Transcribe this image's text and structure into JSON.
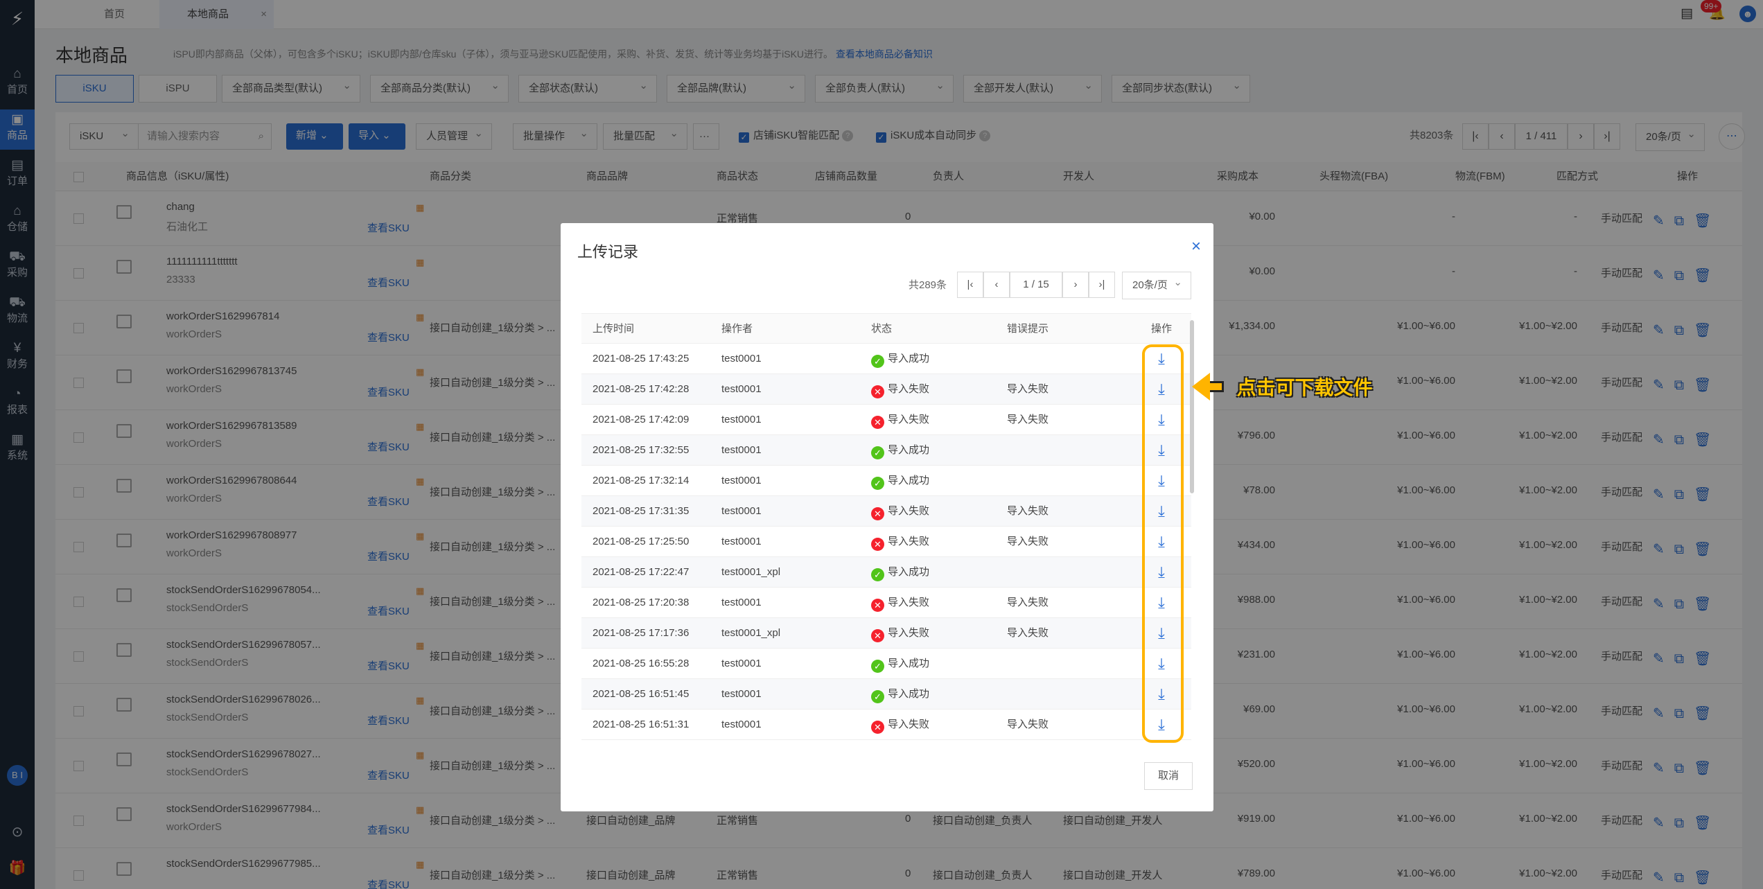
{
  "topbar": {
    "tabs": [
      {
        "label": "首页"
      },
      {
        "label": "本地商品"
      }
    ],
    "close": "×",
    "badge": "99+"
  },
  "sidebar": {
    "items": [
      {
        "label": "首页",
        "icon": "home-icon"
      },
      {
        "label": "商品",
        "icon": "box-icon"
      },
      {
        "label": "订单",
        "icon": "order-icon"
      },
      {
        "label": "仓储",
        "icon": "warehouse-icon"
      },
      {
        "label": "采购",
        "icon": "cart-icon"
      },
      {
        "label": "物流",
        "icon": "truck-icon"
      },
      {
        "label": "财务",
        "icon": "finance-icon"
      },
      {
        "label": "报表",
        "icon": "report-icon"
      },
      {
        "label": "系统",
        "icon": "system-icon"
      }
    ],
    "avatar": "B I"
  },
  "page": {
    "title": "本地商品",
    "desc": "iSPU即内部商品（父体），可包含多个iSKU；iSKU即内部/仓库sku（子体），须与亚马逊SKU匹配使用，采购、补货、发货、统计等业务均基于iSKU进行。",
    "desc_link": "查看本地商品必备知识"
  },
  "filters": {
    "seg": [
      "iSKU",
      "iSPU"
    ],
    "dropdowns": [
      "全部商品类型(默认)",
      "全部商品分类(默认)",
      "全部状态(默认)",
      "全部品牌(默认)",
      "全部负责人(默认)",
      "全部开发人(默认)",
      "全部同步状态(默认)"
    ]
  },
  "toolbar": {
    "field": "iSKU",
    "search_placeholder": "请输入搜索内容",
    "add": "新增",
    "import": "导入",
    "people": "人员管理",
    "batch": "批量操作",
    "match": "批量匹配",
    "more": "···",
    "cb1": "店铺iSKU智能匹配",
    "cb2": "iSKU成本自动同步",
    "total": "共8203条",
    "page": "1",
    "pages": "/ 411",
    "per_page": "20条/页"
  },
  "table": {
    "headers": [
      "商品信息（iSKU/属性)",
      "商品分类",
      "商品品牌",
      "商品状态",
      "店铺商品数量",
      "负责人",
      "开发人",
      "采购成本",
      "头程物流(FBA)",
      "物流(FBM)",
      "匹配方式",
      "操作"
    ],
    "view_sku": "查看SKU",
    "rows": [
      {
        "name": "chang",
        "sub": "石油化工",
        "cat": "",
        "brand": "",
        "status": "正常销售",
        "qty": "0",
        "owner": "",
        "dev": "",
        "cost": "¥0.00",
        "fba": "-",
        "fbm": "-",
        "match": "手动匹配"
      },
      {
        "name": "1111111111ttttttt",
        "sub": "23333",
        "cat": "",
        "brand": "",
        "status": "",
        "qty": "",
        "owner": "",
        "dev": "",
        "cost": "¥0.00",
        "fba": "-",
        "fbm": "-",
        "match": "手动匹配"
      },
      {
        "name": "workOrderS1629967814",
        "sub": "workOrderS",
        "cat": "接口自动创建_1级分类 > ...",
        "brand": "",
        "status": "",
        "qty": "",
        "owner": "",
        "dev": "",
        "cost": "¥1,334.00",
        "fba": "¥1.00~¥6.00",
        "fbm": "¥1.00~¥2.00",
        "match": "手动匹配"
      },
      {
        "name": "workOrderS1629967813745",
        "sub": "workOrderS",
        "cat": "接口自动创建_1级分类 > ...",
        "brand": "",
        "status": "",
        "qty": "",
        "owner": "",
        "dev": "",
        "cost": "",
        "fba": "¥1.00~¥6.00",
        "fbm": "¥1.00~¥2.00",
        "match": "手动匹配"
      },
      {
        "name": "workOrderS1629967813589",
        "sub": "workOrderS",
        "cat": "接口自动创建_1级分类 > ...",
        "brand": "",
        "status": "",
        "qty": "",
        "owner": "",
        "dev": "",
        "cost": "¥796.00",
        "fba": "¥1.00~¥6.00",
        "fbm": "¥1.00~¥2.00",
        "match": "手动匹配"
      },
      {
        "name": "workOrderS1629967808644",
        "sub": "workOrderS",
        "cat": "接口自动创建_1级分类 > ...",
        "brand": "",
        "status": "",
        "qty": "",
        "owner": "",
        "dev": "",
        "cost": "¥78.00",
        "fba": "¥1.00~¥6.00",
        "fbm": "¥1.00~¥2.00",
        "match": "手动匹配"
      },
      {
        "name": "workOrderS1629967808977",
        "sub": "workOrderS",
        "cat": "接口自动创建_1级分类 > ...",
        "brand": "",
        "status": "",
        "qty": "",
        "owner": "",
        "dev": "",
        "cost": "¥434.00",
        "fba": "¥1.00~¥6.00",
        "fbm": "¥1.00~¥2.00",
        "match": "手动匹配"
      },
      {
        "name": "stockSendOrderS16299678054...",
        "sub": "stockSendOrderS",
        "cat": "接口自动创建_1级分类 > ...",
        "brand": "",
        "status": "",
        "qty": "",
        "owner": "",
        "dev": "",
        "cost": "¥988.00",
        "fba": "¥1.00~¥6.00",
        "fbm": "¥1.00~¥2.00",
        "match": "手动匹配"
      },
      {
        "name": "stockSendOrderS16299678057...",
        "sub": "stockSendOrderS",
        "cat": "接口自动创建_1级分类 > ...",
        "brand": "",
        "status": "",
        "qty": "",
        "owner": "",
        "dev": "",
        "cost": "¥231.00",
        "fba": "¥1.00~¥6.00",
        "fbm": "¥1.00~¥2.00",
        "match": "手动匹配"
      },
      {
        "name": "stockSendOrderS16299678026...",
        "sub": "stockSendOrderS",
        "cat": "接口自动创建_1级分类 > ...",
        "brand": "",
        "status": "",
        "qty": "",
        "owner": "",
        "dev": "",
        "cost": "¥69.00",
        "fba": "¥1.00~¥6.00",
        "fbm": "¥1.00~¥2.00",
        "match": "手动匹配"
      },
      {
        "name": "stockSendOrderS16299678027...",
        "sub": "stockSendOrderS",
        "cat": "接口自动创建_1级分类 > ...",
        "brand": "",
        "status": "",
        "qty": "",
        "owner": "",
        "dev": "",
        "cost": "¥520.00",
        "fba": "¥1.00~¥6.00",
        "fbm": "¥1.00~¥2.00",
        "match": "手动匹配"
      },
      {
        "name": "stockSendOrderS16299677984...",
        "sub": "workOrderS",
        "cat": "接口自动创建_1级分类 > ...",
        "brand": "接口自动创建_品牌",
        "status": "正常销售",
        "qty": "0",
        "owner": "接口自动创建_负责人",
        "dev": "接口自动创建_开发人",
        "cost": "¥919.00",
        "fba": "¥1.00~¥6.00",
        "fbm": "¥1.00~¥2.00",
        "match": "手动匹配"
      },
      {
        "name": "stockSendOrderS16299677985...",
        "sub": "",
        "cat": "接口自动创建_1级分类 > ...",
        "brand": "接口自动创建_品牌",
        "status": "正常销售",
        "qty": "0",
        "owner": "接口自动创建_负责人",
        "dev": "接口自动创建_开发人",
        "cost": "¥789.00",
        "fba": "¥1.00~¥6.00",
        "fbm": "¥1.00~¥2.00",
        "match": "手动匹配"
      }
    ]
  },
  "modal": {
    "title": "上传记录",
    "close": "×",
    "total": "共289条",
    "page": "1",
    "pages": "/ 15",
    "per_page": "20条/页",
    "headers": [
      "上传时间",
      "操作者",
      "状态",
      "错误提示",
      "操作"
    ],
    "rows": [
      {
        "time": "2021-08-25 17:43:25",
        "user": "test0001",
        "ok": true,
        "status": "导入成功",
        "err": ""
      },
      {
        "time": "2021-08-25 17:42:28",
        "user": "test0001",
        "ok": false,
        "status": "导入失败",
        "err": "导入失败"
      },
      {
        "time": "2021-08-25 17:42:09",
        "user": "test0001",
        "ok": false,
        "status": "导入失败",
        "err": "导入失败"
      },
      {
        "time": "2021-08-25 17:32:55",
        "user": "test0001",
        "ok": true,
        "status": "导入成功",
        "err": ""
      },
      {
        "time": "2021-08-25 17:32:14",
        "user": "test0001",
        "ok": true,
        "status": "导入成功",
        "err": ""
      },
      {
        "time": "2021-08-25 17:31:35",
        "user": "test0001",
        "ok": false,
        "status": "导入失败",
        "err": "导入失败"
      },
      {
        "time": "2021-08-25 17:25:50",
        "user": "test0001",
        "ok": false,
        "status": "导入失败",
        "err": "导入失败"
      },
      {
        "time": "2021-08-25 17:22:47",
        "user": "test0001_xpl",
        "ok": true,
        "status": "导入成功",
        "err": ""
      },
      {
        "time": "2021-08-25 17:20:38",
        "user": "test0001",
        "ok": false,
        "status": "导入失败",
        "err": "导入失败"
      },
      {
        "time": "2021-08-25 17:17:36",
        "user": "test0001_xpl",
        "ok": false,
        "status": "导入失败",
        "err": "导入失败"
      },
      {
        "time": "2021-08-25 16:55:28",
        "user": "test0001",
        "ok": true,
        "status": "导入成功",
        "err": ""
      },
      {
        "time": "2021-08-25 16:51:45",
        "user": "test0001",
        "ok": true,
        "status": "导入成功",
        "err": ""
      },
      {
        "time": "2021-08-25 16:51:31",
        "user": "test0001",
        "ok": false,
        "status": "导入失败",
        "err": "导入失败"
      }
    ],
    "cancel": "取消"
  },
  "callout": {
    "text": "点击可下载文件"
  },
  "colors": {
    "primary": "#2b6fd6",
    "success": "#52c41a",
    "error": "#f5222d",
    "highlight": "#ffb400",
    "sidebar": "#1e2a3a"
  }
}
